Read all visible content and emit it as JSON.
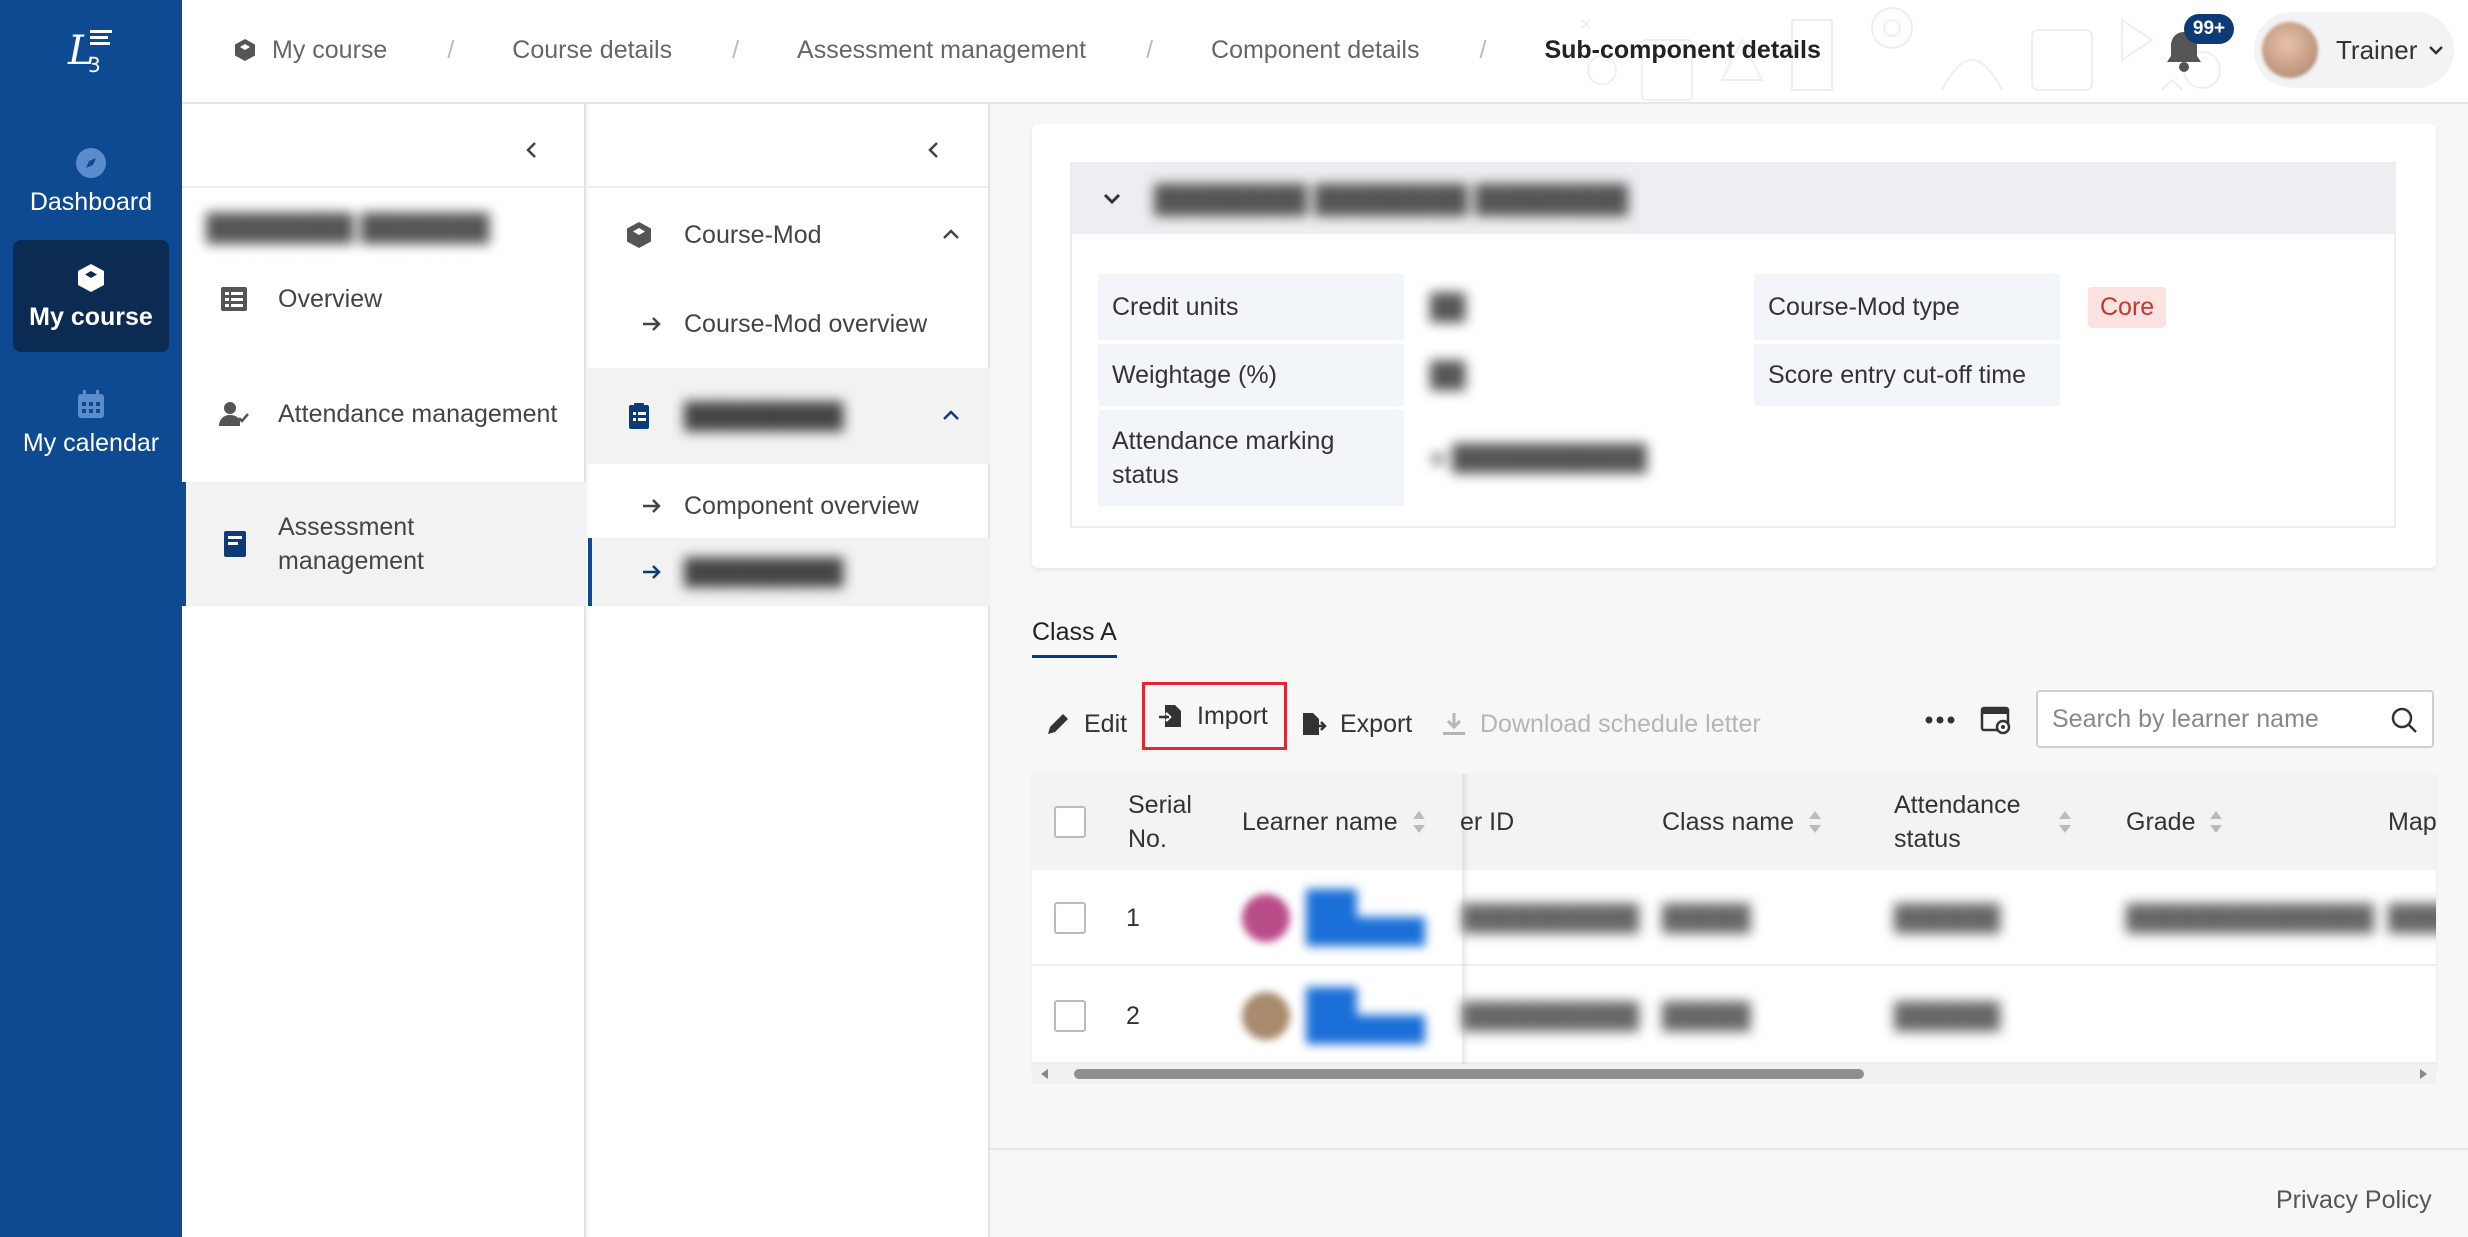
{
  "rail": {
    "items": [
      {
        "label": "Dashboard",
        "icon": "compass-icon"
      },
      {
        "label": "My course",
        "icon": "cube-icon",
        "active": true
      },
      {
        "label": "My calendar",
        "icon": "calendar-icon"
      }
    ]
  },
  "breadcrumb": [
    "My course",
    "Course details",
    "Assessment management",
    "Component details",
    "Sub-component details"
  ],
  "notifications": {
    "badge": "99+"
  },
  "user": {
    "name": "Trainer"
  },
  "panel1": {
    "items": [
      {
        "label": "Overview",
        "icon": "list-icon"
      },
      {
        "label": "Attendance management",
        "icon": "user-check-icon"
      },
      {
        "label": "Assessment management",
        "icon": "book-icon",
        "active": true
      }
    ]
  },
  "panel2": {
    "group1": {
      "label": "Course-Mod",
      "sub": "Course-Mod overview"
    },
    "group2": {
      "sub": "Component overview"
    }
  },
  "info": {
    "credit_units_label": "Credit units",
    "weightage_label": "Weightage (%)",
    "attendance_label": "Attendance marking status",
    "course_mod_type_label": "Course-Mod type",
    "course_mod_type_value": "Core",
    "score_cutoff_label": "Score entry cut-off time"
  },
  "tab": {
    "label": "Class A"
  },
  "toolbar": {
    "edit": "Edit",
    "import": "Import",
    "export": "Export",
    "download": "Download schedule letter"
  },
  "search": {
    "placeholder": "Search by learner name"
  },
  "table": {
    "columns": [
      "Serial No.",
      "Learner name",
      "er ID",
      "Class name",
      "Attendance status",
      "Grade",
      "Map"
    ],
    "rows": [
      {
        "serial": "1"
      },
      {
        "serial": "2"
      }
    ]
  },
  "footer": {
    "privacy": "Privacy Policy"
  },
  "colors": {
    "rail": "#0d4a91",
    "rail_active": "#0b2b52",
    "accent": "#0d3b77",
    "import_highlight": "#e0282e",
    "core_tag_bg": "#fde2e2",
    "core_tag_text": "#c0392b"
  }
}
